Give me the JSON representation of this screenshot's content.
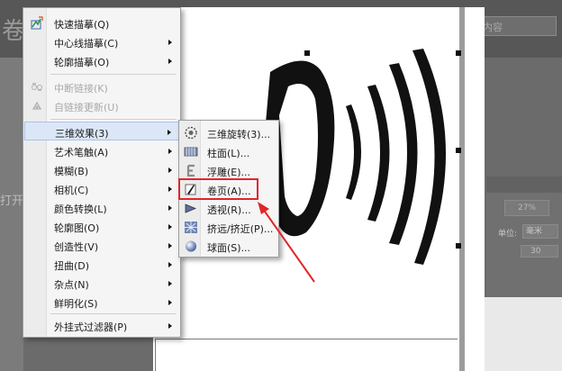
{
  "background": {
    "title_fragment": "卷页",
    "field_text": "内容",
    "left_label": "打开",
    "percent_value": "27%",
    "unit_label": "单位:",
    "unit_value": "毫米",
    "small_field": "30"
  },
  "main_menu": {
    "items": [
      {
        "label": "快速描摹(Q)",
        "icon": "quick-trace-icon",
        "enabled": true,
        "submenu": false
      },
      {
        "label": "中心线描摹(C)",
        "icon": "",
        "enabled": true,
        "submenu": true
      },
      {
        "label": "轮廓描摹(O)",
        "icon": "",
        "enabled": true,
        "submenu": true
      },
      {
        "label": "中断链接(K)",
        "icon": "break-link-icon",
        "enabled": false,
        "submenu": false
      },
      {
        "label": "自链接更新(U)",
        "icon": "update-link-icon",
        "enabled": false,
        "submenu": false
      },
      {
        "label": "三维效果(3)",
        "icon": "",
        "enabled": true,
        "submenu": true,
        "highlighted": true
      },
      {
        "label": "艺术笔触(A)",
        "icon": "",
        "enabled": true,
        "submenu": true
      },
      {
        "label": "模糊(B)",
        "icon": "",
        "enabled": true,
        "submenu": true
      },
      {
        "label": "相机(C)",
        "icon": "",
        "enabled": true,
        "submenu": true
      },
      {
        "label": "颜色转换(L)",
        "icon": "",
        "enabled": true,
        "submenu": true
      },
      {
        "label": "轮廓图(O)",
        "icon": "",
        "enabled": true,
        "submenu": true
      },
      {
        "label": "创造性(V)",
        "icon": "",
        "enabled": true,
        "submenu": true
      },
      {
        "label": "扭曲(D)",
        "icon": "",
        "enabled": true,
        "submenu": true
      },
      {
        "label": "杂点(N)",
        "icon": "",
        "enabled": true,
        "submenu": true
      },
      {
        "label": "鲜明化(S)",
        "icon": "",
        "enabled": true,
        "submenu": true
      },
      {
        "label": "外挂式过滤器(P)",
        "icon": "",
        "enabled": true,
        "submenu": true
      }
    ]
  },
  "sub_menu": {
    "items": [
      {
        "label": "三维旋转(3)...",
        "icon": "3d-rotate-icon"
      },
      {
        "label": "柱面(L)...",
        "icon": "cylinder-icon"
      },
      {
        "label": "浮雕(E)...",
        "icon": "emboss-icon"
      },
      {
        "label": "卷页(A)...",
        "icon": "page-curl-icon",
        "boxed": true
      },
      {
        "label": "透视(R)...",
        "icon": "perspective-icon"
      },
      {
        "label": "挤远/挤近(P)...",
        "icon": "pinch-punch-icon"
      },
      {
        "label": "球面(S)...",
        "icon": "sphere-icon"
      }
    ]
  },
  "colors": {
    "highlight": "#dbe7f7",
    "annotation_red": "#e0262b"
  }
}
